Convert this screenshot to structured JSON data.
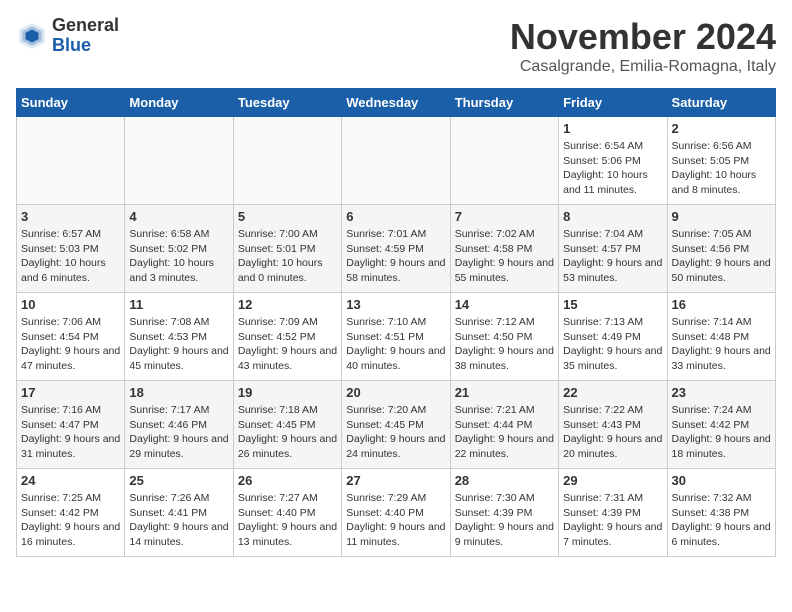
{
  "header": {
    "logo_line1": "General",
    "logo_line2": "Blue",
    "month_title": "November 2024",
    "location": "Casalgrande, Emilia-Romagna, Italy"
  },
  "calendar": {
    "days_of_week": [
      "Sunday",
      "Monday",
      "Tuesday",
      "Wednesday",
      "Thursday",
      "Friday",
      "Saturday"
    ],
    "weeks": [
      [
        {
          "day": "",
          "info": ""
        },
        {
          "day": "",
          "info": ""
        },
        {
          "day": "",
          "info": ""
        },
        {
          "day": "",
          "info": ""
        },
        {
          "day": "",
          "info": ""
        },
        {
          "day": "1",
          "info": "Sunrise: 6:54 AM\nSunset: 5:06 PM\nDaylight: 10 hours and 11 minutes."
        },
        {
          "day": "2",
          "info": "Sunrise: 6:56 AM\nSunset: 5:05 PM\nDaylight: 10 hours and 8 minutes."
        }
      ],
      [
        {
          "day": "3",
          "info": "Sunrise: 6:57 AM\nSunset: 5:03 PM\nDaylight: 10 hours and 6 minutes."
        },
        {
          "day": "4",
          "info": "Sunrise: 6:58 AM\nSunset: 5:02 PM\nDaylight: 10 hours and 3 minutes."
        },
        {
          "day": "5",
          "info": "Sunrise: 7:00 AM\nSunset: 5:01 PM\nDaylight: 10 hours and 0 minutes."
        },
        {
          "day": "6",
          "info": "Sunrise: 7:01 AM\nSunset: 4:59 PM\nDaylight: 9 hours and 58 minutes."
        },
        {
          "day": "7",
          "info": "Sunrise: 7:02 AM\nSunset: 4:58 PM\nDaylight: 9 hours and 55 minutes."
        },
        {
          "day": "8",
          "info": "Sunrise: 7:04 AM\nSunset: 4:57 PM\nDaylight: 9 hours and 53 minutes."
        },
        {
          "day": "9",
          "info": "Sunrise: 7:05 AM\nSunset: 4:56 PM\nDaylight: 9 hours and 50 minutes."
        }
      ],
      [
        {
          "day": "10",
          "info": "Sunrise: 7:06 AM\nSunset: 4:54 PM\nDaylight: 9 hours and 47 minutes."
        },
        {
          "day": "11",
          "info": "Sunrise: 7:08 AM\nSunset: 4:53 PM\nDaylight: 9 hours and 45 minutes."
        },
        {
          "day": "12",
          "info": "Sunrise: 7:09 AM\nSunset: 4:52 PM\nDaylight: 9 hours and 43 minutes."
        },
        {
          "day": "13",
          "info": "Sunrise: 7:10 AM\nSunset: 4:51 PM\nDaylight: 9 hours and 40 minutes."
        },
        {
          "day": "14",
          "info": "Sunrise: 7:12 AM\nSunset: 4:50 PM\nDaylight: 9 hours and 38 minutes."
        },
        {
          "day": "15",
          "info": "Sunrise: 7:13 AM\nSunset: 4:49 PM\nDaylight: 9 hours and 35 minutes."
        },
        {
          "day": "16",
          "info": "Sunrise: 7:14 AM\nSunset: 4:48 PM\nDaylight: 9 hours and 33 minutes."
        }
      ],
      [
        {
          "day": "17",
          "info": "Sunrise: 7:16 AM\nSunset: 4:47 PM\nDaylight: 9 hours and 31 minutes."
        },
        {
          "day": "18",
          "info": "Sunrise: 7:17 AM\nSunset: 4:46 PM\nDaylight: 9 hours and 29 minutes."
        },
        {
          "day": "19",
          "info": "Sunrise: 7:18 AM\nSunset: 4:45 PM\nDaylight: 9 hours and 26 minutes."
        },
        {
          "day": "20",
          "info": "Sunrise: 7:20 AM\nSunset: 4:45 PM\nDaylight: 9 hours and 24 minutes."
        },
        {
          "day": "21",
          "info": "Sunrise: 7:21 AM\nSunset: 4:44 PM\nDaylight: 9 hours and 22 minutes."
        },
        {
          "day": "22",
          "info": "Sunrise: 7:22 AM\nSunset: 4:43 PM\nDaylight: 9 hours and 20 minutes."
        },
        {
          "day": "23",
          "info": "Sunrise: 7:24 AM\nSunset: 4:42 PM\nDaylight: 9 hours and 18 minutes."
        }
      ],
      [
        {
          "day": "24",
          "info": "Sunrise: 7:25 AM\nSunset: 4:42 PM\nDaylight: 9 hours and 16 minutes."
        },
        {
          "day": "25",
          "info": "Sunrise: 7:26 AM\nSunset: 4:41 PM\nDaylight: 9 hours and 14 minutes."
        },
        {
          "day": "26",
          "info": "Sunrise: 7:27 AM\nSunset: 4:40 PM\nDaylight: 9 hours and 13 minutes."
        },
        {
          "day": "27",
          "info": "Sunrise: 7:29 AM\nSunset: 4:40 PM\nDaylight: 9 hours and 11 minutes."
        },
        {
          "day": "28",
          "info": "Sunrise: 7:30 AM\nSunset: 4:39 PM\nDaylight: 9 hours and 9 minutes."
        },
        {
          "day": "29",
          "info": "Sunrise: 7:31 AM\nSunset: 4:39 PM\nDaylight: 9 hours and 7 minutes."
        },
        {
          "day": "30",
          "info": "Sunrise: 7:32 AM\nSunset: 4:38 PM\nDaylight: 9 hours and 6 minutes."
        }
      ]
    ]
  }
}
